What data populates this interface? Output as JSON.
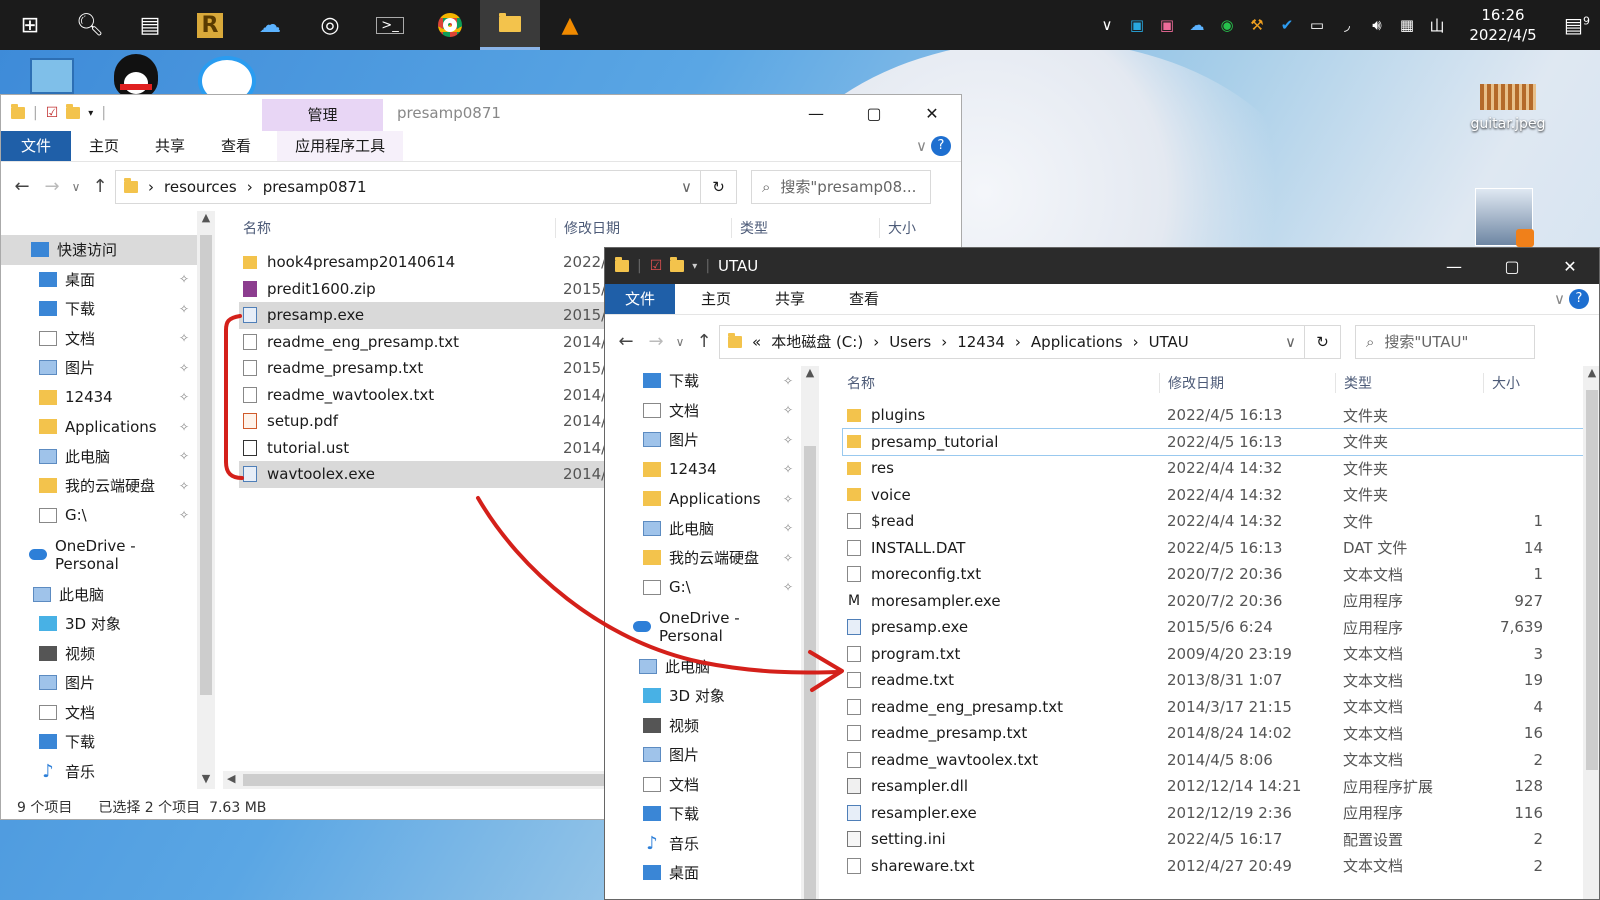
{
  "taskbar": {
    "apps": [
      "windows-start",
      "search",
      "task-view",
      "r-app",
      "cloud-app",
      "obs",
      "terminal",
      "chrome",
      "file-explorer",
      "vlc"
    ],
    "clock_time": "16:26",
    "clock_date": "2022/4/5",
    "notification_count": "9"
  },
  "desktop": {
    "guitar_label": "guitar.jpeg"
  },
  "win1": {
    "title": "presamp0871",
    "manage_tab": "管理",
    "app_tools_tab": "应用程序工具",
    "tabs": [
      "文件",
      "主页",
      "共享",
      "查看"
    ],
    "breadcrumb": [
      "resources",
      "presamp0871"
    ],
    "search_placeholder": "搜索\"presamp08...",
    "columns": {
      "name": "名称",
      "date": "修改日期",
      "type": "类型",
      "size": "大小"
    },
    "nav": [
      {
        "label": "快速访问",
        "icon": "star-icon"
      },
      {
        "label": "桌面",
        "icon": "desktop-icon"
      },
      {
        "label": "下载",
        "icon": "download-icon"
      },
      {
        "label": "文档",
        "icon": "document-icon"
      },
      {
        "label": "图片",
        "icon": "pictures-icon"
      },
      {
        "label": "12434",
        "icon": "folder-icon"
      },
      {
        "label": "Applications",
        "icon": "folder-icon"
      },
      {
        "label": "此电脑",
        "icon": "pc-icon"
      },
      {
        "label": "我的云端硬盘",
        "icon": "folder-icon"
      },
      {
        "label": "G:\\",
        "icon": "drive-icon"
      },
      {
        "label": "OneDrive - Personal",
        "icon": "onedrive-icon"
      },
      {
        "label": "此电脑",
        "icon": "pc-icon"
      },
      {
        "label": "3D 对象",
        "icon": "3d-icon"
      },
      {
        "label": "视频",
        "icon": "video-icon"
      },
      {
        "label": "图片",
        "icon": "pictures-icon"
      },
      {
        "label": "文档",
        "icon": "document-icon"
      },
      {
        "label": "下载",
        "icon": "download-icon"
      },
      {
        "label": "音乐",
        "icon": "music-icon"
      }
    ],
    "files": [
      {
        "name": "hook4presamp20140614",
        "date": "2022/",
        "kind": "folder"
      },
      {
        "name": "predit1600.zip",
        "date": "2015/",
        "kind": "zip"
      },
      {
        "name": "presamp.exe",
        "date": "2015/",
        "kind": "exe",
        "selected": true
      },
      {
        "name": "readme_eng_presamp.txt",
        "date": "2014/",
        "kind": "txt"
      },
      {
        "name": "readme_presamp.txt",
        "date": "2015/",
        "kind": "txt"
      },
      {
        "name": "readme_wavtoolex.txt",
        "date": "2014/",
        "kind": "txt"
      },
      {
        "name": "setup.pdf",
        "date": "2014/",
        "kind": "pdf"
      },
      {
        "name": "tutorial.ust",
        "date": "2014/",
        "kind": "ust"
      },
      {
        "name": "wavtoolex.exe",
        "date": "2014/",
        "kind": "exe",
        "selected": true
      }
    ],
    "status_count": "9 个项目",
    "status_selected": "已选择 2 个项目  7.63 MB"
  },
  "win2": {
    "title": "UTAU",
    "tabs": [
      "文件",
      "主页",
      "共享",
      "查看"
    ],
    "breadcrumb": [
      "本地磁盘 (C:)",
      "Users",
      "12434",
      "Applications",
      "UTAU"
    ],
    "search_placeholder": "搜索\"UTAU\"",
    "columns": {
      "name": "名称",
      "date": "修改日期",
      "type": "类型",
      "size": "大小"
    },
    "nav": [
      {
        "label": "下载",
        "icon": "download-icon"
      },
      {
        "label": "文档",
        "icon": "document-icon"
      },
      {
        "label": "图片",
        "icon": "pictures-icon"
      },
      {
        "label": "12434",
        "icon": "folder-icon"
      },
      {
        "label": "Applications",
        "icon": "folder-icon"
      },
      {
        "label": "此电脑",
        "icon": "pc-icon"
      },
      {
        "label": "我的云端硬盘",
        "icon": "folder-icon"
      },
      {
        "label": "G:\\",
        "icon": "drive-icon"
      },
      {
        "label": "OneDrive - Personal",
        "icon": "onedrive-icon"
      },
      {
        "label": "此电脑",
        "icon": "pc-icon"
      },
      {
        "label": "3D 对象",
        "icon": "3d-icon"
      },
      {
        "label": "视频",
        "icon": "video-icon"
      },
      {
        "label": "图片",
        "icon": "pictures-icon"
      },
      {
        "label": "文档",
        "icon": "document-icon"
      },
      {
        "label": "下载",
        "icon": "download-icon"
      },
      {
        "label": "音乐",
        "icon": "music-icon"
      },
      {
        "label": "桌面",
        "icon": "desktop-icon"
      }
    ],
    "files": [
      {
        "name": "plugins",
        "date": "2022/4/5 16:13",
        "type": "文件夹",
        "size": "",
        "kind": "folder"
      },
      {
        "name": "presamp_tutorial",
        "date": "2022/4/5 16:13",
        "type": "文件夹",
        "size": "",
        "kind": "folder"
      },
      {
        "name": "res",
        "date": "2022/4/4 14:32",
        "type": "文件夹",
        "size": "",
        "kind": "folder"
      },
      {
        "name": "voice",
        "date": "2022/4/4 14:32",
        "type": "文件夹",
        "size": "",
        "kind": "folder"
      },
      {
        "name": "$read",
        "date": "2022/4/4 14:32",
        "type": "文件",
        "size": "1",
        "kind": "txt"
      },
      {
        "name": "INSTALL.DAT",
        "date": "2022/4/5 16:13",
        "type": "DAT 文件",
        "size": "14",
        "kind": "txt"
      },
      {
        "name": "moreconfig.txt",
        "date": "2020/7/2 20:36",
        "type": "文本文档",
        "size": "1",
        "kind": "txt"
      },
      {
        "name": "moresampler.exe",
        "date": "2020/7/2 20:36",
        "type": "应用程序",
        "size": "927",
        "kind": "m"
      },
      {
        "name": "presamp.exe",
        "date": "2015/5/6 6:24",
        "type": "应用程序",
        "size": "7,639",
        "kind": "exe"
      },
      {
        "name": "program.txt",
        "date": "2009/4/20 23:19",
        "type": "文本文档",
        "size": "3",
        "kind": "txt"
      },
      {
        "name": "readme.txt",
        "date": "2013/8/31 1:07",
        "type": "文本文档",
        "size": "19",
        "kind": "txt"
      },
      {
        "name": "readme_eng_presamp.txt",
        "date": "2014/3/17 21:15",
        "type": "文本文档",
        "size": "4",
        "kind": "txt"
      },
      {
        "name": "readme_presamp.txt",
        "date": "2014/8/24 14:02",
        "type": "文本文档",
        "size": "16",
        "kind": "txt"
      },
      {
        "name": "readme_wavtoolex.txt",
        "date": "2014/4/5 8:06",
        "type": "文本文档",
        "size": "2",
        "kind": "txt"
      },
      {
        "name": "resampler.dll",
        "date": "2012/12/14 14:21",
        "type": "应用程序扩展",
        "size": "128",
        "kind": "dll"
      },
      {
        "name": "resampler.exe",
        "date": "2012/12/19 2:36",
        "type": "应用程序",
        "size": "116",
        "kind": "exe"
      },
      {
        "name": "setting.ini",
        "date": "2022/4/5 16:17",
        "type": "配置设置",
        "size": "2",
        "kind": "ini"
      },
      {
        "name": "shareware.txt",
        "date": "2012/4/27 20:49",
        "type": "文本文档",
        "size": "2",
        "kind": "txt"
      }
    ]
  },
  "colors": {
    "annotation": "#d4201a",
    "ribbon_file": "#1f5fa8",
    "manage_tab": "#e8d6f5"
  }
}
